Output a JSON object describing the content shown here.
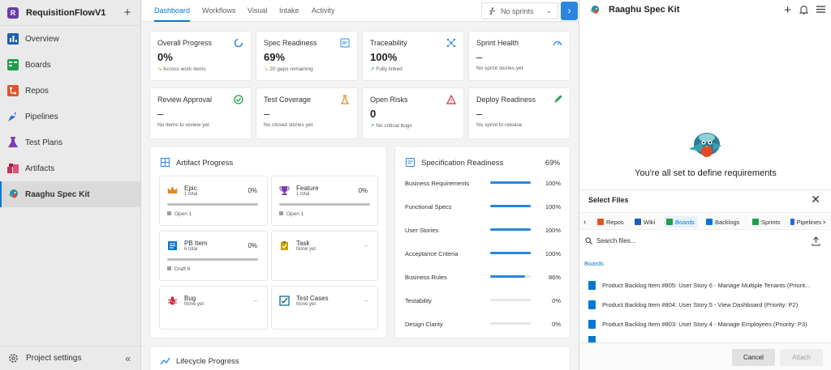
{
  "sidebar": {
    "org_initial": "R",
    "project": "RequisitionFlowV1",
    "add": "+",
    "items": [
      {
        "label": "Overview"
      },
      {
        "label": "Boards"
      },
      {
        "label": "Repos"
      },
      {
        "label": "Pipelines"
      },
      {
        "label": "Test Plans"
      },
      {
        "label": "Artifacts"
      },
      {
        "label": "Raaghu Spec Kit"
      }
    ],
    "settings": "Project settings",
    "collapse": "«"
  },
  "tabs": [
    "Dashboard",
    "Workflows",
    "Visual",
    "Intake",
    "Activity"
  ],
  "sprint_filter": "No sprints",
  "metrics": [
    {
      "title": "Overall Progress",
      "value": "0%",
      "sub": "Across work items"
    },
    {
      "title": "Spec Readiness",
      "value": "69%",
      "sub": "20 gaps remaining"
    },
    {
      "title": "Traceability",
      "value": "100%",
      "sub": "Fully linked"
    },
    {
      "title": "Sprint Health",
      "value": "–",
      "sub": "No sprint stories yet"
    },
    {
      "title": "Review Approval",
      "value": "–",
      "sub": "No items to review yet"
    },
    {
      "title": "Test Coverage",
      "value": "–",
      "sub": "No closed stories yet"
    },
    {
      "title": "Open Risks",
      "value": "0",
      "sub": "No critical bugs"
    },
    {
      "title": "Deploy Readiness",
      "value": "–",
      "sub": "No sprint to release"
    }
  ],
  "artifact_progress": {
    "title": "Artifact Progress",
    "items": [
      {
        "name": "Epic",
        "sub": "1 total",
        "pct": "0%",
        "foot": "Open 1"
      },
      {
        "name": "Feature",
        "sub": "1 total",
        "pct": "0%",
        "foot": "Open 1"
      },
      {
        "name": "PB Item",
        "sub": "6 total",
        "pct": "0%",
        "foot": "Draft 6"
      },
      {
        "name": "Task",
        "sub": "None yet",
        "pct": "–",
        "foot": ""
      },
      {
        "name": "Bug",
        "sub": "None yet",
        "pct": "–",
        "foot": ""
      },
      {
        "name": "Test Cases",
        "sub": "None yet",
        "pct": "–",
        "foot": ""
      }
    ]
  },
  "spec_readiness": {
    "title": "Specification Readiness",
    "total": "69%",
    "rows": [
      {
        "label": "Business Requirements",
        "value": "100%",
        "fill": 1.0
      },
      {
        "label": "Functional Specs",
        "value": "100%",
        "fill": 1.0
      },
      {
        "label": "User Stories",
        "value": "100%",
        "fill": 1.0
      },
      {
        "label": "Acceptance Criteria",
        "value": "100%",
        "fill": 1.0
      },
      {
        "label": "Business Rules",
        "value": "86%",
        "fill": 0.86
      },
      {
        "label": "Testability",
        "value": "0%",
        "fill": 0
      },
      {
        "label": "Design Clarity",
        "value": "0%",
        "fill": 0
      }
    ]
  },
  "lifecycle": {
    "title": "Lifecycle Progress"
  },
  "panel": {
    "title": "Raaghu Spec Kit",
    "empty_msg": "You're all set to define requirements"
  },
  "select_files": {
    "title": "Select Files",
    "sources": [
      "Repos",
      "Wiki",
      "Boards",
      "Backlogs",
      "Sprints",
      "Pipelines"
    ],
    "search_placeholder": "Search files...",
    "group": "Boards",
    "files": [
      "Product Backlog Item #805: User Story 6 - Manage Multiple Tenants (Priorit...",
      "Product Backlog Item #804: User Story 5 - View Dashboard (Priority: P2)",
      "Product Backlog Item #803: User Story 4 - Manage Employees (Priority: P3)"
    ],
    "cancel": "Cancel",
    "attach": "Attach"
  }
}
